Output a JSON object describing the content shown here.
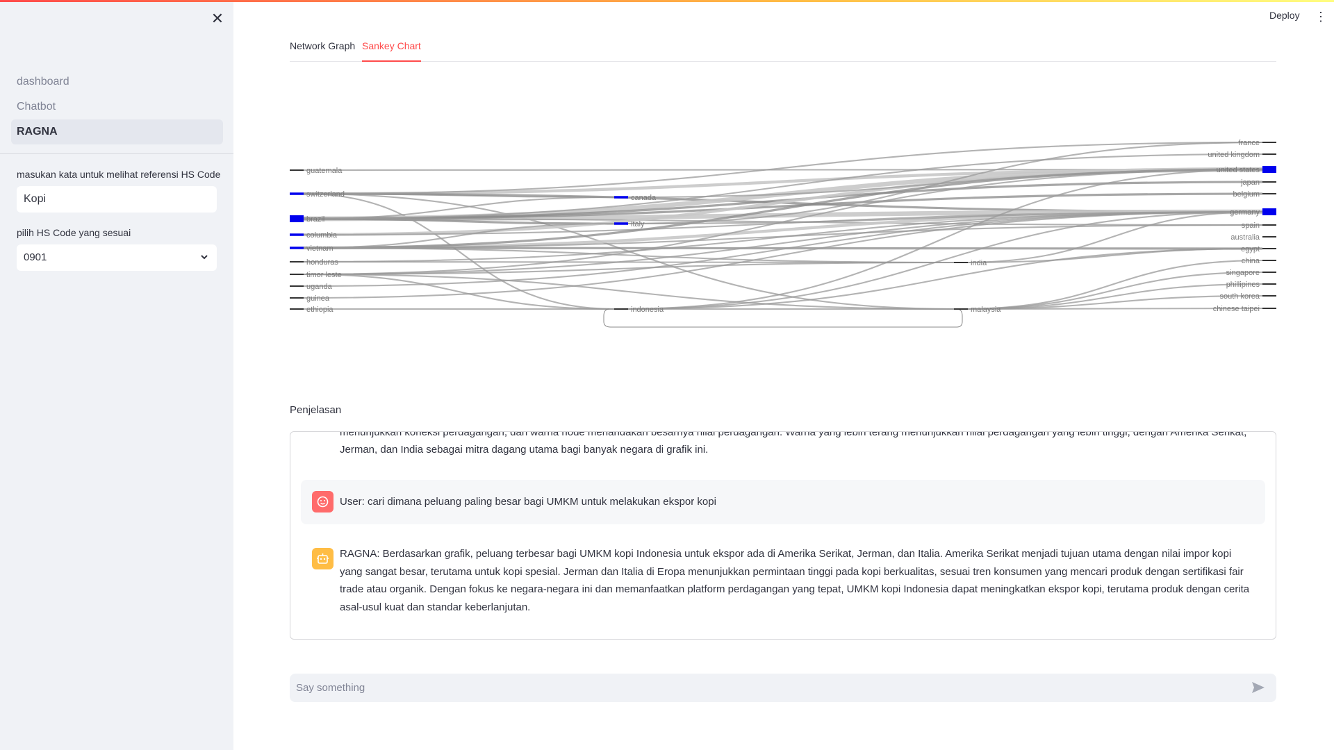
{
  "header": {
    "deploy_label": "Deploy",
    "menu_icon": "kebab-menu-icon",
    "accent_gradient": [
      "#ff4b4b",
      "#ffbd45",
      "#fffd80"
    ]
  },
  "sidebar": {
    "close_icon": "close-icon",
    "nav": [
      {
        "label": "dashboard",
        "active": false
      },
      {
        "label": "Chatbot",
        "active": false
      },
      {
        "label": "RAGNA",
        "active": true
      }
    ],
    "hs_search": {
      "label": "masukan kata untuk melihat referensi HS Code",
      "value": "Kopi"
    },
    "hs_select": {
      "label": "pilih HS Code yang sesuai",
      "value": "0901"
    }
  },
  "tabs": [
    {
      "label": "Network Graph",
      "active": false
    },
    {
      "label": "Sankey Chart",
      "active": true
    }
  ],
  "chart_data": {
    "type": "sankey",
    "node_color_high": "#0000ee",
    "node_color_low": "#333333",
    "sources": [
      "guatemala",
      "switzerland",
      "brazil",
      "columbia",
      "vietnam",
      "honduras",
      "timor leste",
      "uganda",
      "guinea",
      "ethiopia"
    ],
    "middle_left": [
      "canada",
      "italy",
      "indonesia"
    ],
    "middle_right": [
      "india",
      "malaysia"
    ],
    "targets": [
      "france",
      "united kingdom",
      "united states",
      "japan",
      "belgium",
      "germany",
      "spain",
      "australia",
      "egypt",
      "china",
      "singapore",
      "phillipines",
      "south korea",
      "chinese taipei"
    ],
    "high_value_nodes": [
      "switzerland",
      "brazil",
      "columbia",
      "vietnam",
      "canada",
      "italy",
      "united states",
      "germany"
    ],
    "links": [
      {
        "source": "guatemala",
        "target": "united states",
        "value": 1
      },
      {
        "source": "switzerland",
        "target": "canada",
        "value": 1
      },
      {
        "source": "switzerland",
        "target": "united states",
        "value": 3
      },
      {
        "source": "switzerland",
        "target": "germany",
        "value": 2
      },
      {
        "source": "switzerland",
        "target": "france",
        "value": 1
      },
      {
        "source": "switzerland",
        "target": "indonesia",
        "value": 1
      },
      {
        "source": "switzerland",
        "target": "malaysia",
        "value": 1
      },
      {
        "source": "brazil",
        "target": "united states",
        "value": 5
      },
      {
        "source": "brazil",
        "target": "germany",
        "value": 5
      },
      {
        "source": "brazil",
        "target": "italy",
        "value": 2
      },
      {
        "source": "brazil",
        "target": "belgium",
        "value": 2
      },
      {
        "source": "brazil",
        "target": "japan",
        "value": 2
      },
      {
        "source": "brazil",
        "target": "united kingdom",
        "value": 1
      },
      {
        "source": "brazil",
        "target": "spain",
        "value": 1
      },
      {
        "source": "brazil",
        "target": "canada",
        "value": 1
      },
      {
        "source": "columbia",
        "target": "united states",
        "value": 3
      },
      {
        "source": "columbia",
        "target": "germany",
        "value": 1
      },
      {
        "source": "vietnam",
        "target": "germany",
        "value": 3
      },
      {
        "source": "vietnam",
        "target": "united states",
        "value": 2
      },
      {
        "source": "vietnam",
        "target": "egypt",
        "value": 2
      },
      {
        "source": "vietnam",
        "target": "italy",
        "value": 1
      },
      {
        "source": "vietnam",
        "target": "spain",
        "value": 1
      },
      {
        "source": "vietnam",
        "target": "india",
        "value": 1
      },
      {
        "source": "honduras",
        "target": "germany",
        "value": 1
      },
      {
        "source": "honduras",
        "target": "india",
        "value": 1
      },
      {
        "source": "timor leste",
        "target": "indonesia",
        "value": 1
      },
      {
        "source": "timor leste",
        "target": "india",
        "value": 1
      },
      {
        "source": "timor leste",
        "target": "germany",
        "value": 1
      },
      {
        "source": "timor leste",
        "target": "malaysia",
        "value": 1
      },
      {
        "source": "timor leste",
        "target": "united states",
        "value": 1
      },
      {
        "source": "uganda",
        "target": "germany",
        "value": 1
      },
      {
        "source": "guinea",
        "target": "germany",
        "value": 1
      },
      {
        "source": "ethiopia",
        "target": "indonesia",
        "value": 1
      },
      {
        "source": "indonesia",
        "target": "united states",
        "value": 1
      },
      {
        "source": "indonesia",
        "target": "germany",
        "value": 1
      },
      {
        "source": "indonesia",
        "target": "egypt",
        "value": 1
      },
      {
        "source": "indonesia",
        "target": "malaysia",
        "value": 1
      },
      {
        "source": "india",
        "target": "germany",
        "value": 1
      },
      {
        "source": "india",
        "target": "egypt",
        "value": 1
      },
      {
        "source": "malaysia",
        "target": "china",
        "value": 1
      },
      {
        "source": "malaysia",
        "target": "singapore",
        "value": 1
      },
      {
        "source": "malaysia",
        "target": "phillipines",
        "value": 1
      },
      {
        "source": "malaysia",
        "target": "south korea",
        "value": 1
      },
      {
        "source": "malaysia",
        "target": "chinese taipei",
        "value": 1
      },
      {
        "source": "canada",
        "target": "united states",
        "value": 1
      },
      {
        "source": "italy",
        "target": "germany",
        "value": 1
      },
      {
        "source": "italy",
        "target": "france",
        "value": 1
      }
    ]
  },
  "explanation": {
    "label": "Penjelasan",
    "messages": [
      {
        "role": "assistant_fragment",
        "line1": "menunjukkan koneksi perdagangan, dan warna node menandakan besarnya nilai perdagangan. Warna yang lebih terang menunjukkan nilai perdagangan yang lebih tinggi, dengan Amerika Serikat,",
        "line2": "Jerman, dan India sebagai mitra dagang utama bagi banyak negara di grafik ini."
      },
      {
        "role": "user",
        "avatar_icon": "user-face-icon",
        "text": "User: cari dimana peluang paling besar bagi UMKM untuk melakukan ekspor kopi"
      },
      {
        "role": "assistant",
        "avatar_icon": "robot-icon",
        "text": "RAGNA: Berdasarkan grafik, peluang terbesar bagi UMKM kopi Indonesia untuk ekspor ada di Amerika Serikat, Jerman, dan Italia. Amerika Serikat menjadi tujuan utama dengan nilai impor kopi yang sangat besar, terutama untuk kopi spesial. Jerman dan Italia di Eropa menunjukkan permintaan tinggi pada kopi berkualitas, sesuai tren konsumen yang mencari produk dengan sertifikasi fair trade atau organik. Dengan fokus ke negara-negara ini dan memanfaatkan platform perdagangan yang tepat, UMKM kopi Indonesia dapat meningkatkan ekspor kopi, terutama produk dengan cerita asal-usul kuat dan standar keberlanjutan."
      }
    ]
  },
  "chat_input": {
    "placeholder": "Say something",
    "send_icon": "send-icon"
  }
}
